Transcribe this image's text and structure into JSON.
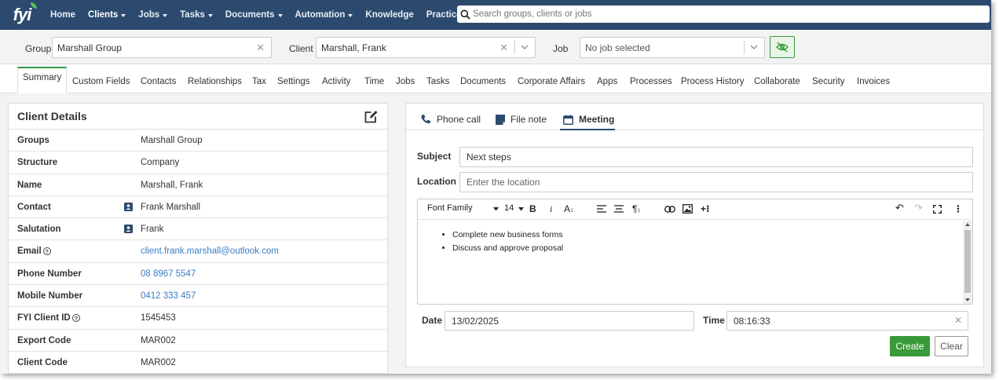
{
  "nav": {
    "logo": "fyi",
    "items": [
      {
        "label": "Home",
        "dropdown": false
      },
      {
        "label": "Clients",
        "dropdown": true
      },
      {
        "label": "Jobs",
        "dropdown": true
      },
      {
        "label": "Tasks",
        "dropdown": true
      },
      {
        "label": "Documents",
        "dropdown": true
      },
      {
        "label": "Automation",
        "dropdown": true
      },
      {
        "label": "Knowledge",
        "dropdown": false
      },
      {
        "label": "Practice",
        "dropdown": false
      }
    ],
    "search_placeholder": "Search groups, clients or jobs"
  },
  "filters": {
    "group_label": "Group",
    "group_value": "Marshall Group",
    "client_label": "Client",
    "client_value": "Marshall, Frank",
    "job_label": "Job",
    "job_value": "No job selected"
  },
  "tabs": [
    "Summary",
    "Custom Fields",
    "Contacts",
    "Relationships",
    "Tax",
    "Settings",
    "Activity",
    "Time",
    "Jobs",
    "Tasks",
    "Documents",
    "Corporate Affairs",
    "Apps",
    "Processes",
    "Process History",
    "Collaborate",
    "Security",
    "Invoices"
  ],
  "active_tab": "Summary",
  "client_details": {
    "title": "Client Details",
    "rows": [
      {
        "label": "Groups",
        "value": "Marshall Group"
      },
      {
        "label": "Structure",
        "value": "Company"
      },
      {
        "label": "Name",
        "value": "Marshall, Frank"
      },
      {
        "label": "Contact",
        "value": "Frank Marshall"
      },
      {
        "label": "Salutation",
        "value": "Frank"
      },
      {
        "label": "Email",
        "value": "client.frank.marshall@outlook.com"
      },
      {
        "label": "Phone Number",
        "value": "08 8967 5547"
      },
      {
        "label": "Mobile Number",
        "value": "0412 333 457"
      },
      {
        "label": "FYI Client ID",
        "value": "1545453"
      },
      {
        "label": "Export Code",
        "value": "MAR002"
      },
      {
        "label": "Client Code",
        "value": "MAR002"
      }
    ]
  },
  "activity": {
    "tabs": [
      "Phone call",
      "File note",
      "Meeting"
    ],
    "active_tab": "Meeting",
    "subject_label": "Subject",
    "subject_value": "Next steps",
    "location_label": "Location",
    "location_placeholder": "Enter the location",
    "editor": {
      "font_family": "Font Family",
      "font_size": "14",
      "bullets": [
        "Complete new business forms",
        "Discuss and approve proposal"
      ]
    },
    "date_label": "Date",
    "date_value": "13/02/2025",
    "time_label": "Time",
    "time_value": "08:16:33",
    "create_label": "Create",
    "clear_label": "Clear"
  },
  "colors": {
    "nav_bg": "#2c4a6e",
    "accent_green": "#3a9a3a",
    "link_blue": "#3b7dc4",
    "tab_active": "#2e9b47"
  }
}
